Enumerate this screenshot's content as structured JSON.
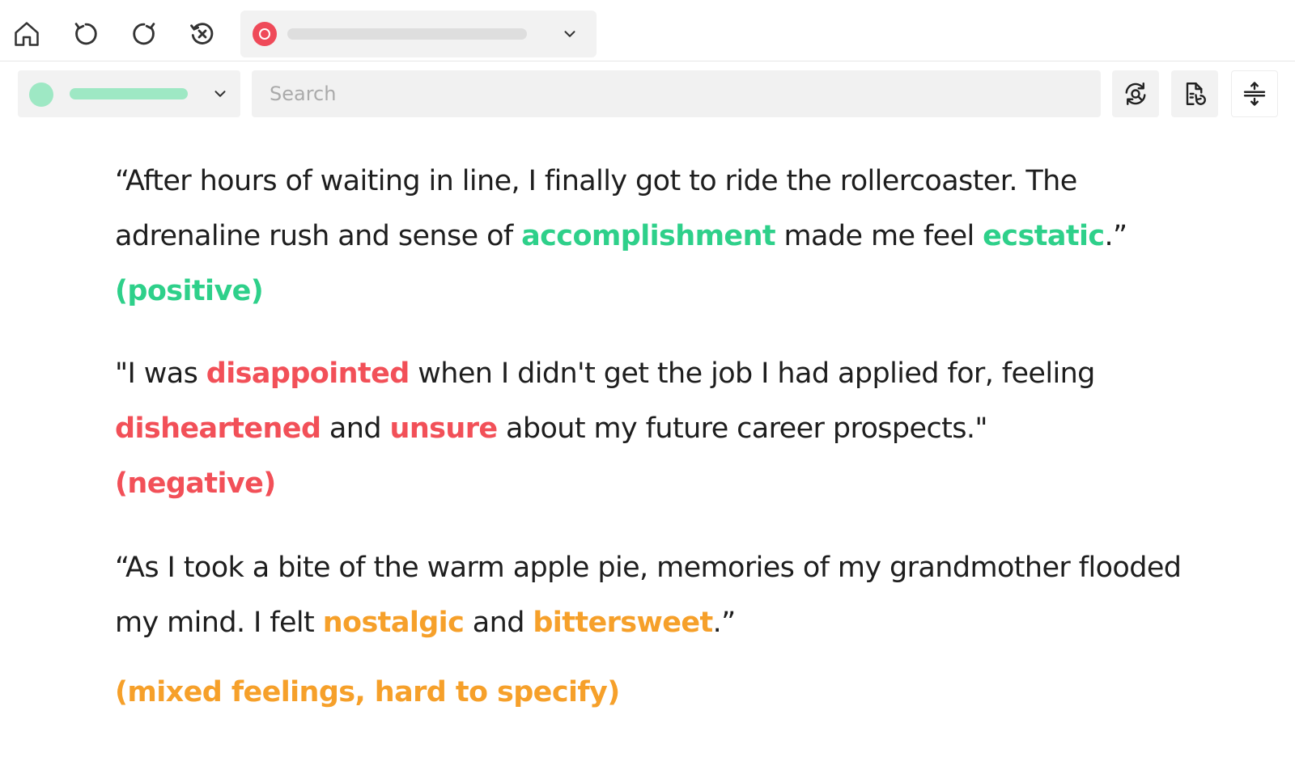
{
  "toolbar": {
    "icons": [
      "home-icon",
      "rotate-ccw-icon",
      "rotate-cw-icon",
      "history-clear-icon"
    ],
    "tab_select_icon": "target-icon",
    "model_select_color": "#9ee8c4"
  },
  "search": {
    "placeholder": "Search",
    "value": ""
  },
  "tools": [
    "refresh-search-icon",
    "document-refresh-icon",
    "collapse-expand-icon"
  ],
  "colors": {
    "positive": "#2ed08a",
    "negative": "#f25058",
    "mixed": "#f6a02a",
    "tab_status": "#ef4a59"
  },
  "examples": [
    {
      "parts": [
        "“After hours of waiting in line, I finally got to ride the rollercoaster. The adrenaline rush and sense of ",
        "accomplishment",
        " made me feel ",
        "ecstatic",
        ".”"
      ],
      "label": "(positive)"
    },
    {
      "parts": [
        "\"I was ",
        "disappointed",
        " when I didn't get the job I had applied for, feeling ",
        "disheartened",
        " and ",
        "unsure",
        " about my future career prospects.\""
      ],
      "label": "(negative)"
    },
    {
      "parts": [
        "“As I took a bite of the warm apple pie, memories of my grandmother flooded my mind. I felt ",
        "nostalgic",
        " and ",
        "bittersweet",
        ".”"
      ],
      "label": "(mixed feelings, hard to specify)"
    }
  ]
}
